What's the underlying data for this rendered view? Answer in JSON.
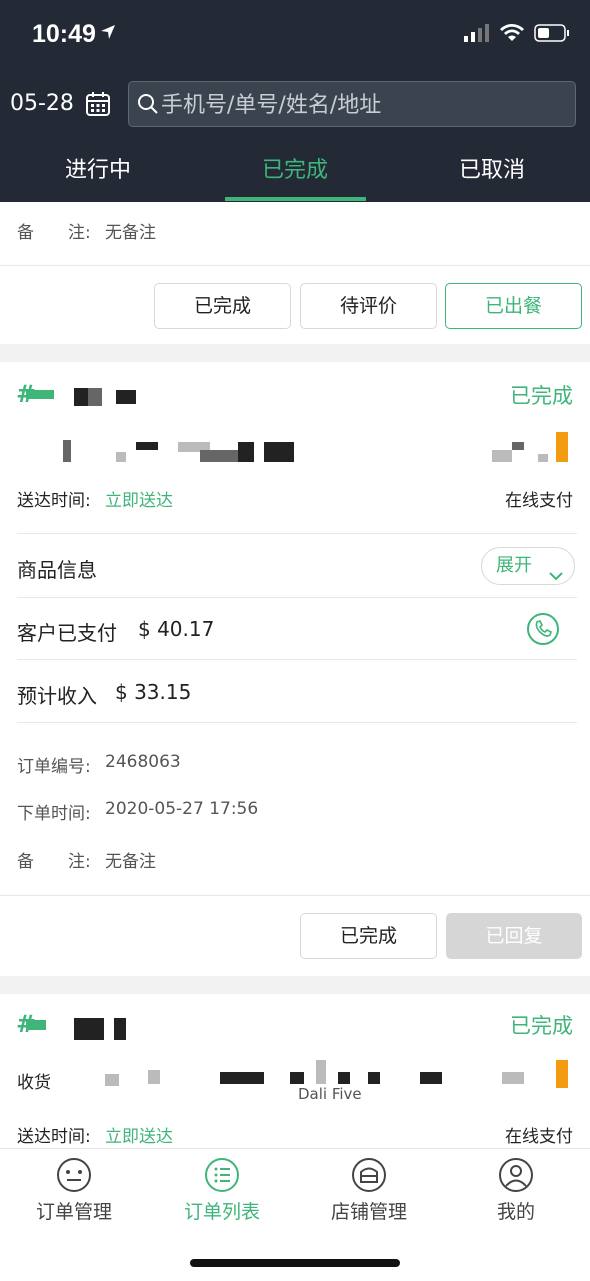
{
  "status_bar": {
    "time": "10:49"
  },
  "header": {
    "date": "05-28",
    "search_placeholder": "手机号/单号/姓名/地址",
    "tabs": [
      {
        "label": "进行中"
      },
      {
        "label": "已完成"
      },
      {
        "label": "已取消"
      }
    ],
    "active_tab": 1
  },
  "prev_order": {
    "remark_label": "备　　注:",
    "remark_value": "无备注",
    "buttons": [
      "已完成",
      "待评价",
      "已出餐"
    ]
  },
  "order": {
    "status": "已完成",
    "delivery_label": "送达时间:",
    "delivery_value": "立即送达",
    "payment": "在线支付",
    "goods_label": "商品信息",
    "expand_label": "展开",
    "paid_label": "客户已支付",
    "paid_value": "$ 40.17",
    "income_label": "预计收入",
    "income_value": "$ 33.15",
    "order_no_label": "订单编号:",
    "order_no_value": "2468063",
    "order_time_label": "下单时间:",
    "order_time_value": "2020-05-27 17:56",
    "remark_label": "备　　注:",
    "remark_value": "无备注",
    "buttons": [
      "已完成",
      "已回复"
    ]
  },
  "next_order": {
    "status": "已完成",
    "receiver_label": "收货",
    "partial_text": "Dali Five",
    "delivery_label": "送达时间:",
    "delivery_value": "立即送达",
    "payment": "在线支付"
  },
  "tabbar": {
    "items": [
      {
        "label": "订单管理",
        "icon": "smile-icon"
      },
      {
        "label": "订单列表",
        "icon": "list-icon"
      },
      {
        "label": "店铺管理",
        "icon": "shop-icon"
      },
      {
        "label": "我的",
        "icon": "user-icon"
      }
    ],
    "active": 1
  },
  "colors": {
    "accent": "#3fb57a",
    "header_bg": "#232a35",
    "orange": "#f39c12"
  }
}
